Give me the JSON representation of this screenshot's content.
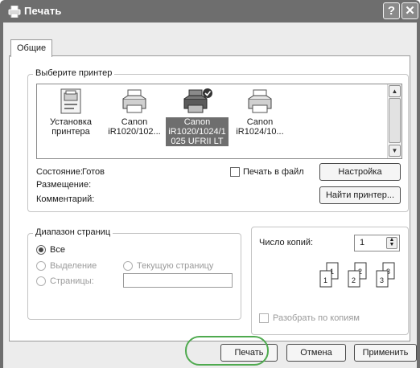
{
  "window": {
    "title": "Печать",
    "help_label": "?",
    "close_label": "✕"
  },
  "tabs": [
    {
      "label": "Общие"
    }
  ],
  "printer_group": {
    "legend": "Выберите принтер",
    "printers": [
      {
        "label_line1": "Установка",
        "label_line2": "принтера",
        "icon": "add-printer-icon"
      },
      {
        "label_line1": "Canon",
        "label_line2": "iR1020/102...",
        "icon": "printer-icon"
      },
      {
        "label_line1": "Canon",
        "label_line2": "iR1020/1024/1",
        "label_line3": "025 UFRII LT",
        "icon": "default-printer-icon",
        "selected": true
      },
      {
        "label_line1": "Canon",
        "label_line2": "iR1024/10...",
        "icon": "printer-icon"
      }
    ],
    "status_label": "Состояние:",
    "status_value": "Готов",
    "location_label": "Размещение:",
    "comment_label": "Комментарий:",
    "print_to_file_label": "Печать в файл",
    "settings_button": "Настройка",
    "find_printer_button": "Найти принтер..."
  },
  "range_group": {
    "legend": "Диапазон страниц",
    "all_label": "Все",
    "selection_label": "Выделение",
    "current_page_label": "Текущую страницу",
    "pages_label": "Страницы:"
  },
  "copies": {
    "label": "Число копий:",
    "value": "1",
    "collate_label": "Разобрать по копиям",
    "sets": [
      [
        "1",
        "1"
      ],
      [
        "2",
        "2"
      ],
      [
        "3",
        "3"
      ]
    ]
  },
  "buttons": {
    "print": "Печать",
    "cancel": "Отмена",
    "apply": "Применить"
  },
  "colors": {
    "titlebar": "#6e6e6e",
    "highlight_ring": "#4faa4f",
    "selection": "#6e6e6e"
  }
}
